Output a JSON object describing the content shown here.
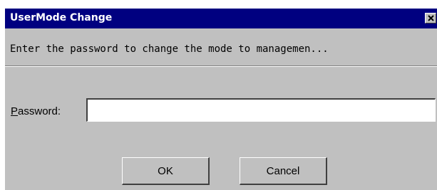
{
  "window": {
    "title": "UserMode Change",
    "close_icon": "close-icon"
  },
  "message": "Enter the password to change the mode to managemen...",
  "password": {
    "label_first": "P",
    "label_rest": "assword:",
    "value": ""
  },
  "buttons": {
    "ok_label": "OK",
    "cancel_label": "Cancel"
  },
  "colors": {
    "titlebar": "#000080",
    "dialog_bg": "#c0c0c0"
  }
}
